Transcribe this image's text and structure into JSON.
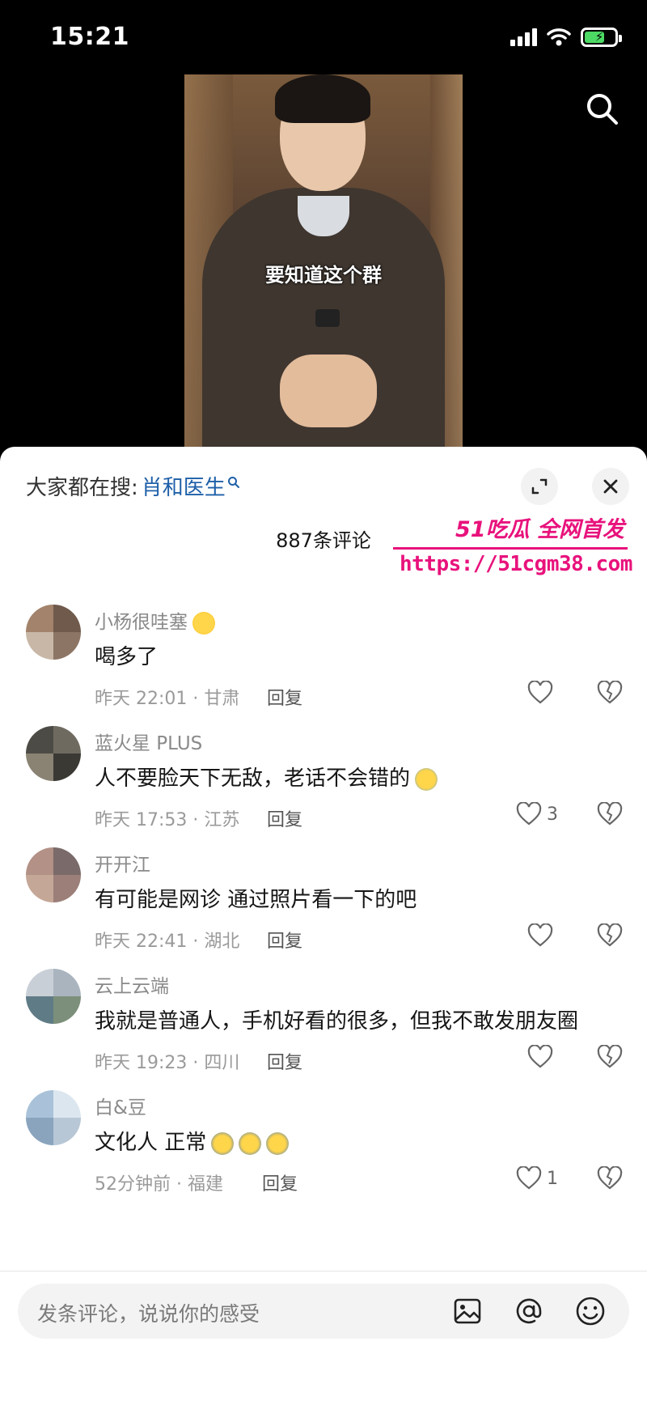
{
  "status_bar": {
    "time": "15:21"
  },
  "video": {
    "caption": "要知道这个群"
  },
  "sheet": {
    "search_prefix": "大家都在搜:",
    "search_term": "肖和医生",
    "comment_count": "887条评论"
  },
  "watermark": {
    "title": "51吃瓜 全网首发",
    "url": "https://51cgm38.com"
  },
  "comments": [
    {
      "user": "小杨很哇塞",
      "text": "喝多了",
      "meta": "昨天 22:01 · 甘肃",
      "reply": "回复",
      "likes": ""
    },
    {
      "user": "蓝火星 PLUS",
      "text": "人不要脸天下无敌，老话不会错的",
      "meta": "昨天 17:53 · 江苏",
      "reply": "回复",
      "likes": "3"
    },
    {
      "user": "开开江",
      "text": "有可能是网诊 通过照片看一下的吧",
      "meta": "昨天 22:41 · 湖北",
      "reply": "回复",
      "likes": ""
    },
    {
      "user": "云上云端",
      "text": "我就是普通人，手机好看的很多，但我不敢发朋友圈",
      "meta": "昨天 19:23 · 四川",
      "reply": "回复",
      "likes": ""
    },
    {
      "user": "白&豆",
      "text": "文化人 正常",
      "meta": "52分钟前 · 福建",
      "reply": "回复",
      "likes": "1"
    }
  ],
  "input": {
    "placeholder": "发条评论，说说你的感受"
  },
  "colors": {
    "accent_link": "#1e5fa8",
    "watermark": "#e8127c",
    "battery": "#4cd964"
  }
}
